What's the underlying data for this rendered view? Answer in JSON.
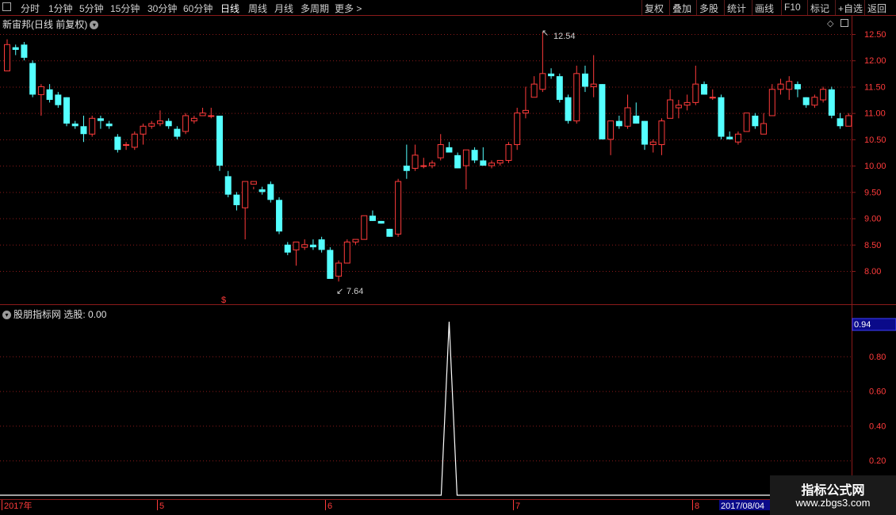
{
  "toolbar": {
    "left_items": [
      "分时",
      "1分钟",
      "5分钟",
      "15分钟",
      "30分钟",
      "60分钟",
      "日线",
      "周线",
      "月线",
      "多周期",
      "更多 >"
    ],
    "active": "日线",
    "right_items": [
      "复权",
      "叠加",
      "多股",
      "统计",
      "画线",
      "F10",
      "标记",
      "+自选",
      "返回"
    ]
  },
  "main_chart": {
    "title": "新宙邦(日线 前复权)",
    "high_label": "12.54",
    "low_label": "7.64",
    "marker": "$",
    "price_axis": [
      "12.50",
      "12.00",
      "11.50",
      "11.00",
      "10.50",
      "10.00",
      "9.50",
      "9.00",
      "8.50",
      "8.00"
    ]
  },
  "indicator": {
    "title": "股朋指标网",
    "label": "选股: 0.00",
    "current_value": "0.94",
    "axis": [
      "0.80",
      "0.60",
      "0.40",
      "0.20"
    ]
  },
  "time_axis": {
    "labels": [
      "2017年",
      "5",
      "6",
      "7",
      "8"
    ],
    "current_date": "2017/08/04"
  },
  "watermark": {
    "line1": "指标公式网",
    "line2": "www.zbgs3.com"
  },
  "colors": {
    "up": "#ff3b3b",
    "down": "#54ffff",
    "grid": "#8b1a1a",
    "indicator_line": "#ffffff"
  },
  "chart_data": {
    "type": "candlestick",
    "ohlc_open_high_low_close": [
      [
        11.8,
        12.4,
        11.8,
        12.3
      ],
      [
        12.25,
        12.3,
        12.1,
        12.2
      ],
      [
        12.3,
        12.35,
        12.0,
        12.05
      ],
      [
        11.95,
        12.0,
        11.3,
        11.35
      ],
      [
        11.35,
        11.55,
        10.95,
        11.5
      ],
      [
        11.45,
        11.55,
        11.2,
        11.25
      ],
      [
        11.35,
        11.4,
        11.1,
        11.15
      ],
      [
        11.3,
        11.3,
        10.75,
        10.8
      ],
      [
        10.8,
        10.85,
        10.7,
        10.75
      ],
      [
        10.75,
        10.95,
        10.45,
        10.6
      ],
      [
        10.6,
        10.95,
        10.55,
        10.9
      ],
      [
        10.9,
        10.95,
        10.7,
        10.85
      ],
      [
        10.8,
        10.85,
        10.7,
        10.75
      ],
      [
        10.55,
        10.6,
        10.25,
        10.3
      ],
      [
        10.4,
        10.45,
        10.3,
        10.4
      ],
      [
        10.35,
        10.65,
        10.3,
        10.6
      ],
      [
        10.6,
        10.8,
        10.4,
        10.75
      ],
      [
        10.75,
        10.85,
        10.7,
        10.8
      ],
      [
        10.8,
        11.05,
        10.75,
        10.85
      ],
      [
        10.85,
        10.9,
        10.7,
        10.75
      ],
      [
        10.7,
        10.75,
        10.5,
        10.55
      ],
      [
        10.65,
        11.0,
        10.6,
        10.95
      ],
      [
        10.85,
        10.95,
        10.8,
        10.9
      ],
      [
        10.95,
        11.1,
        10.95,
        11.0
      ],
      [
        10.95,
        11.1,
        10.9,
        10.95
      ],
      [
        10.95,
        10.95,
        9.9,
        10.0
      ],
      [
        9.8,
        9.9,
        9.4,
        9.45
      ],
      [
        9.45,
        9.5,
        9.15,
        9.25
      ],
      [
        9.2,
        9.7,
        8.6,
        9.7
      ],
      [
        9.65,
        9.6,
        9.55,
        9.7
      ],
      [
        9.55,
        9.6,
        9.45,
        9.5
      ],
      [
        9.65,
        9.7,
        9.3,
        9.35
      ],
      [
        9.35,
        9.4,
        8.7,
        8.75
      ],
      [
        8.5,
        8.55,
        8.3,
        8.35
      ],
      [
        8.4,
        8.55,
        8.1,
        8.55
      ],
      [
        8.45,
        8.6,
        8.4,
        8.5
      ],
      [
        8.5,
        8.6,
        8.4,
        8.45
      ],
      [
        8.6,
        8.65,
        8.35,
        8.4
      ],
      [
        8.4,
        8.45,
        7.85,
        7.85
      ],
      [
        7.9,
        8.2,
        7.8,
        8.15
      ],
      [
        8.15,
        8.6,
        8.15,
        8.55
      ],
      [
        8.55,
        8.6,
        8.5,
        8.6
      ],
      [
        8.6,
        9.05,
        8.6,
        9.05
      ],
      [
        9.05,
        9.15,
        8.95,
        8.95
      ],
      [
        8.95,
        8.95,
        8.9,
        8.9
      ],
      [
        8.8,
        8.8,
        8.65,
        8.65
      ],
      [
        8.7,
        9.75,
        8.65,
        9.7
      ],
      [
        10.0,
        10.4,
        9.75,
        9.9
      ],
      [
        9.95,
        10.4,
        9.9,
        10.2
      ],
      [
        10.0,
        10.15,
        9.95,
        10.0
      ],
      [
        10.0,
        10.1,
        9.95,
        10.05
      ],
      [
        10.15,
        10.6,
        10.1,
        10.4
      ],
      [
        10.35,
        10.45,
        10.25,
        10.25
      ],
      [
        10.2,
        10.25,
        9.95,
        9.95
      ],
      [
        10.0,
        10.3,
        9.55,
        10.3
      ],
      [
        10.3,
        10.35,
        10.05,
        10.1
      ],
      [
        10.1,
        10.35,
        10.0,
        10.0
      ],
      [
        10.0,
        10.1,
        9.95,
        10.05
      ],
      [
        10.05,
        10.1,
        10.0,
        10.1
      ],
      [
        10.1,
        10.45,
        10.05,
        10.4
      ],
      [
        10.4,
        11.1,
        10.3,
        11.0
      ],
      [
        11.0,
        11.5,
        10.9,
        11.05
      ],
      [
        11.3,
        11.7,
        11.3,
        11.55
      ],
      [
        11.45,
        12.54,
        11.4,
        11.75
      ],
      [
        11.75,
        11.85,
        11.65,
        11.7
      ],
      [
        11.7,
        11.75,
        11.2,
        11.25
      ],
      [
        11.3,
        11.35,
        10.8,
        10.85
      ],
      [
        10.85,
        11.9,
        10.8,
        11.75
      ],
      [
        11.75,
        11.9,
        11.4,
        11.5
      ],
      [
        11.5,
        12.1,
        11.3,
        11.55
      ],
      [
        11.55,
        11.55,
        10.5,
        10.5
      ],
      [
        10.5,
        10.8,
        10.2,
        10.85
      ],
      [
        10.85,
        10.95,
        10.7,
        10.75
      ],
      [
        10.75,
        11.35,
        10.7,
        11.1
      ],
      [
        10.95,
        11.2,
        10.8,
        10.8
      ],
      [
        10.85,
        10.85,
        10.3,
        10.4
      ],
      [
        10.4,
        10.5,
        10.25,
        10.45
      ],
      [
        10.4,
        10.9,
        10.2,
        10.85
      ],
      [
        10.9,
        11.45,
        10.9,
        11.25
      ],
      [
        11.1,
        11.25,
        10.9,
        11.15
      ],
      [
        11.15,
        11.35,
        11.05,
        11.2
      ],
      [
        11.2,
        11.9,
        11.15,
        11.55
      ],
      [
        11.55,
        11.6,
        11.35,
        11.35
      ],
      [
        11.3,
        11.45,
        11.25,
        11.3
      ],
      [
        11.3,
        11.35,
        10.5,
        10.55
      ],
      [
        10.55,
        10.65,
        10.5,
        10.5
      ],
      [
        10.45,
        10.65,
        10.4,
        10.6
      ],
      [
        10.65,
        11.0,
        10.65,
        11.0
      ],
      [
        10.95,
        11.0,
        10.7,
        10.75
      ],
      [
        10.6,
        11.0,
        10.6,
        10.8
      ],
      [
        10.95,
        11.55,
        10.95,
        11.45
      ],
      [
        11.45,
        11.65,
        11.35,
        11.55
      ],
      [
        11.45,
        11.7,
        11.25,
        11.6
      ],
      [
        11.55,
        11.6,
        11.3,
        11.45
      ],
      [
        11.3,
        11.3,
        11.1,
        11.15
      ],
      [
        11.15,
        11.35,
        11.1,
        11.3
      ],
      [
        11.25,
        11.5,
        11.2,
        11.45
      ],
      [
        11.45,
        11.5,
        10.9,
        10.95
      ],
      [
        10.9,
        11.0,
        10.7,
        10.75
      ],
      [
        10.75,
        11.0,
        10.75,
        10.95
      ]
    ],
    "indicator_series": {
      "name": "选股",
      "values_note": "zero except a single spike",
      "spike_index": 52,
      "spike_value": 1.0
    },
    "price_range": [
      7.64,
      12.54
    ],
    "indicator_range": [
      0,
      1.0
    ]
  }
}
